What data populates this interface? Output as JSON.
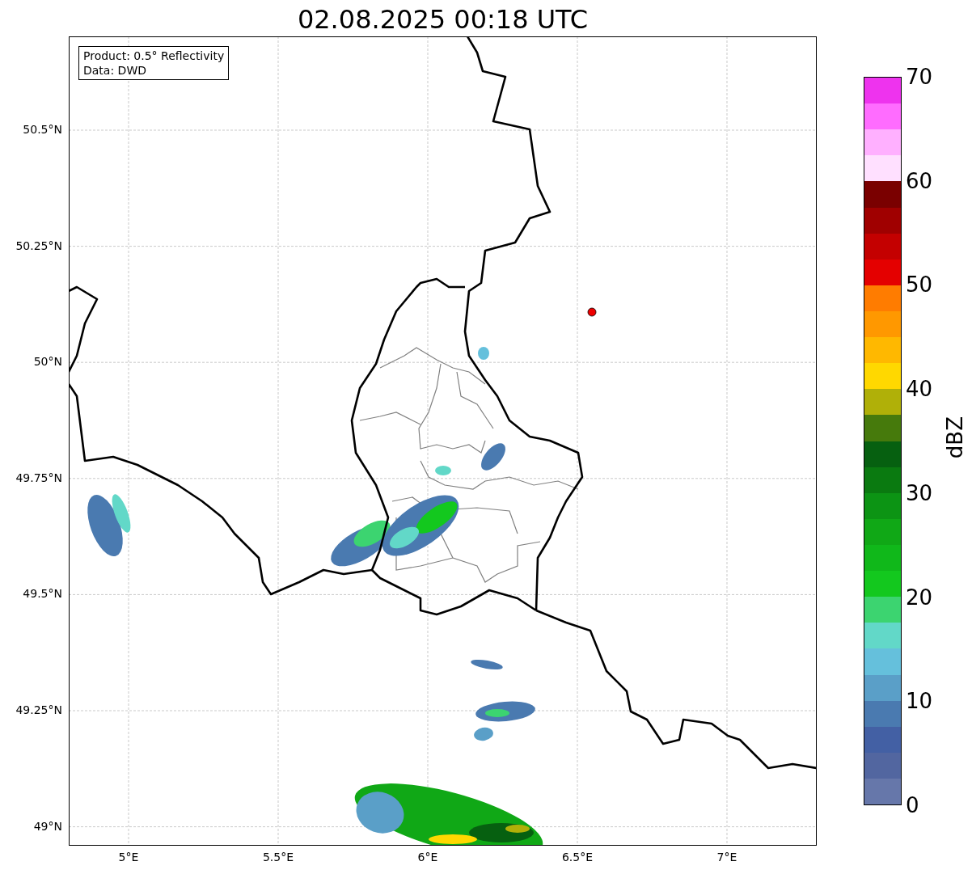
{
  "title": "02.08.2025 00:18 UTC",
  "info_box": {
    "lines": [
      "Product: 0.5° Reflectivity",
      "Data: DWD"
    ]
  },
  "map": {
    "x_ticks": [
      "5°E",
      "5.5°E",
      "6°E",
      "6.5°E",
      "7°E"
    ],
    "y_ticks": [
      "50.5°N",
      "50.25°N",
      "50°N",
      "49.75°N",
      "49.5°N",
      "49.25°N",
      "49°N"
    ]
  },
  "colorbar": {
    "label": "dBZ",
    "ticks": [
      "70",
      "60",
      "50",
      "40",
      "30",
      "20",
      "10",
      "0"
    ],
    "segments": [
      {
        "color": "#ee33ee"
      },
      {
        "color": "#ff6cff"
      },
      {
        "color": "#ffb0ff"
      },
      {
        "color": "#ffe0ff"
      },
      {
        "color": "#7a0000"
      },
      {
        "color": "#a00000"
      },
      {
        "color": "#c40000"
      },
      {
        "color": "#e40000"
      },
      {
        "color": "#ff7c00"
      },
      {
        "color": "#ff9800"
      },
      {
        "color": "#ffb800"
      },
      {
        "color": "#ffd800"
      },
      {
        "color": "#b0b008"
      },
      {
        "color": "#467a0c"
      },
      {
        "color": "#066010"
      },
      {
        "color": "#0a7a10"
      },
      {
        "color": "#0c9414"
      },
      {
        "color": "#10a816"
      },
      {
        "color": "#10b81a"
      },
      {
        "color": "#13c81e"
      },
      {
        "color": "#3cd470"
      },
      {
        "color": "#62d8c8"
      },
      {
        "color": "#65c0dc"
      },
      {
        "color": "#5a9fc8"
      },
      {
        "color": "#4a7ab0"
      },
      {
        "color": "#4360a4"
      },
      {
        "color": "#5266a0"
      },
      {
        "color": "#6677aa"
      }
    ]
  }
}
